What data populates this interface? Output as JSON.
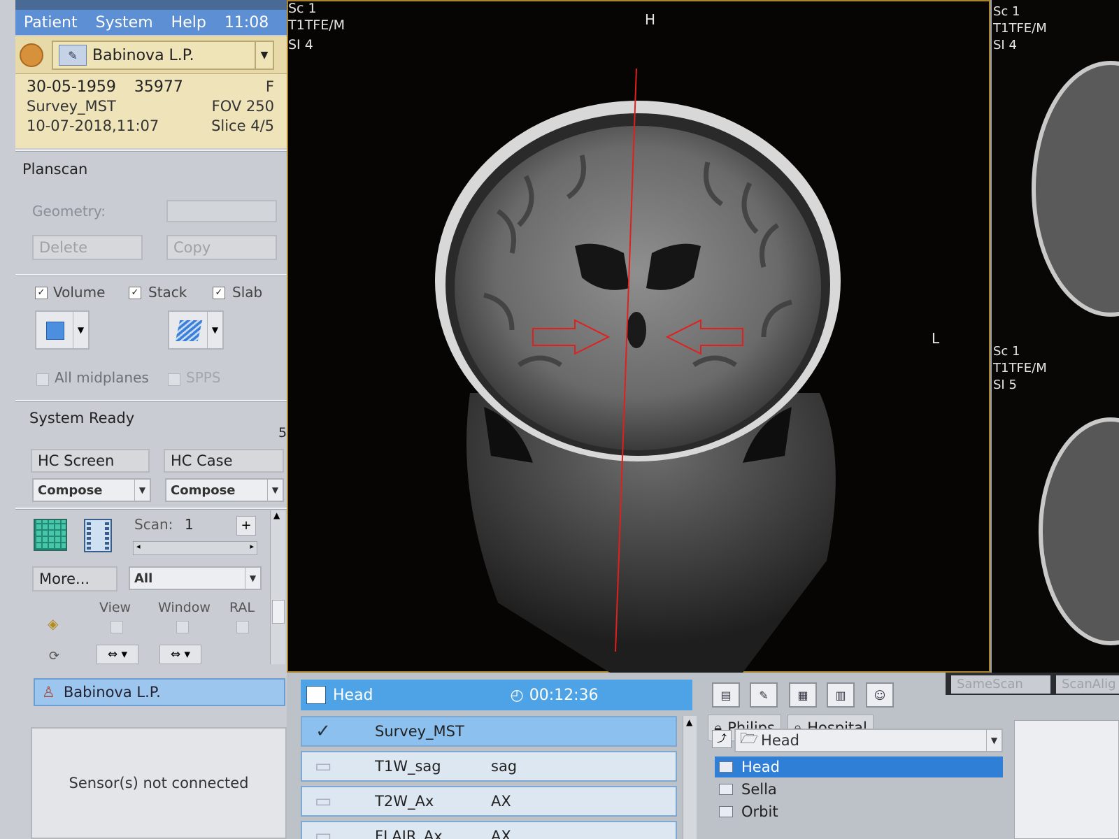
{
  "menu": {
    "items": [
      "Patient",
      "System",
      "Help"
    ],
    "clock": "11:08"
  },
  "patient": {
    "name": "Babinova L.P.",
    "dob": "30-05-1959",
    "id": "35977",
    "sex": "F",
    "protocol": "Survey_MST",
    "fov": "FOV 250",
    "datetime": "10-07-2018,11:07",
    "slice": "Slice 4/5"
  },
  "planscan": {
    "title": "Planscan",
    "geometry_label": "Geometry:",
    "delete_label": "Delete",
    "copy_label": "Copy",
    "volume_label": "Volume",
    "stack_label": "Stack",
    "slab_label": "Slab",
    "all_midplanes_label": "All midplanes",
    "spps_label": "SPPS"
  },
  "system": {
    "status": "System Ready",
    "count": "5",
    "hc_screen_label": "HC Screen",
    "hc_case_label": "HC Case",
    "hc_screen_value": "Compose",
    "hc_case_value": "Compose",
    "scan_label": "Scan:",
    "scan_value": "1",
    "more_label": "More...",
    "filter_value": "All",
    "view_label": "View",
    "window_label": "Window",
    "ral_label": "RAL"
  },
  "patient_bar": {
    "name": "Babinova L.P."
  },
  "sensor": {
    "message": "Sensor(s) not connected"
  },
  "viewer": {
    "sc": "Sc 1",
    "seq": "T1TFE/M",
    "si": "SI 4",
    "top_marker": "H",
    "side_marker": "L"
  },
  "viewer2": {
    "top": {
      "sc": "Sc 1",
      "seq": "T1TFE/M",
      "si": "SI 4"
    },
    "mid": {
      "sc": "Sc 1",
      "seq": "T1TFE/M",
      "si": "SI 5"
    }
  },
  "exam": {
    "title": "Head",
    "timer": "00:12:36",
    "scans": [
      {
        "name": "Survey_MST",
        "orientation": ""
      },
      {
        "name": "T1W_sag",
        "orientation": "sag"
      },
      {
        "name": "T2W_Ax",
        "orientation": "AX"
      },
      {
        "name": "FLAIR_Ax",
        "orientation": "AX"
      }
    ]
  },
  "library": {
    "tab_philips": "Philips",
    "tab_hospital": "Hospital",
    "folder": "Head",
    "items": [
      "Head",
      "Sella",
      "Orbit"
    ]
  },
  "scan_buttons": {
    "same_scan": "SameScan",
    "scan_align": "ScanAlig"
  },
  "colors": {
    "menu_blue": "#5c8fd4",
    "header_beige": "#efe3ba",
    "exam_blue": "#4ea3e6",
    "selection": "#2f7fd6",
    "marker_red": "#e0201e"
  }
}
